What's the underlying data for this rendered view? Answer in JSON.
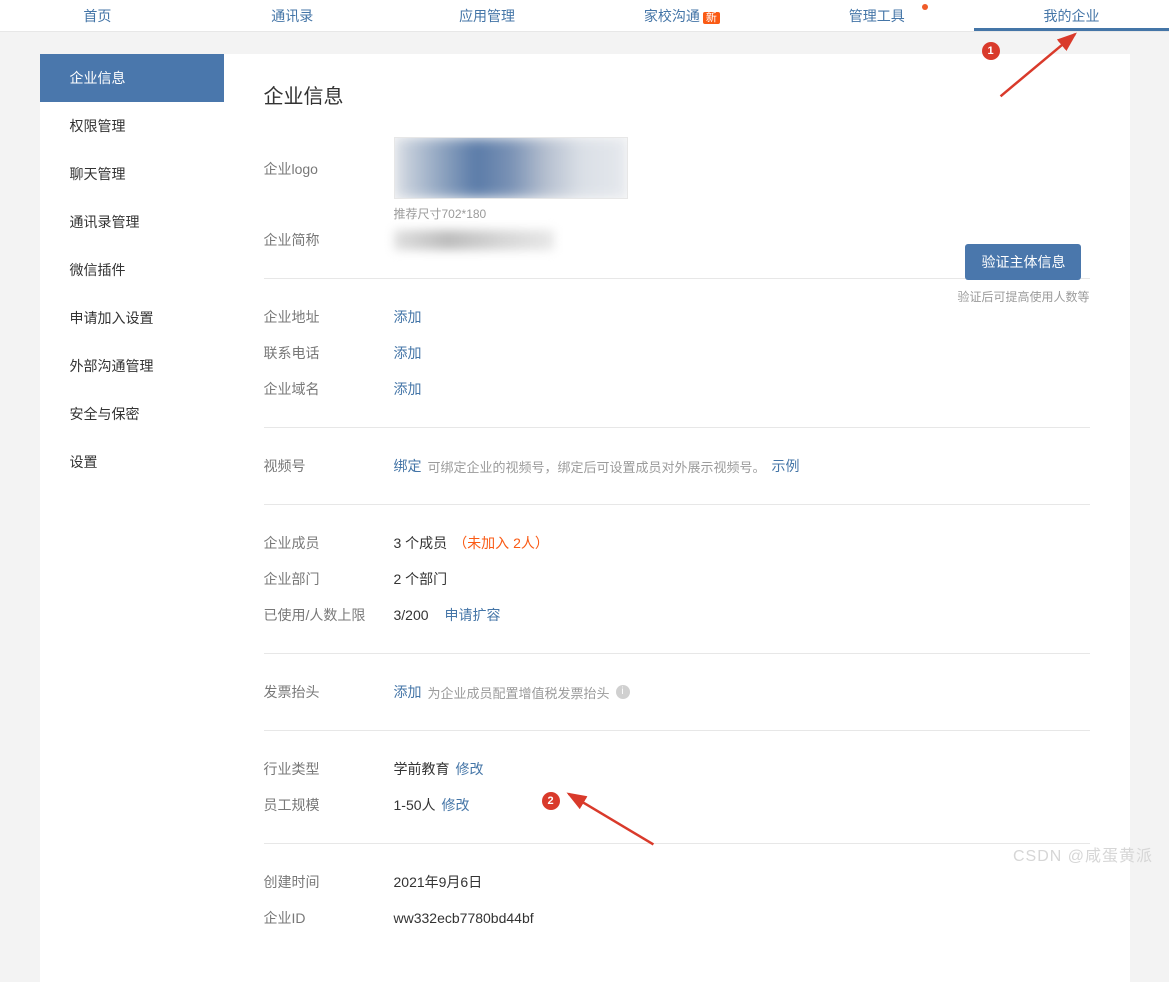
{
  "nav": {
    "items": [
      {
        "label": "首页"
      },
      {
        "label": "通讯录"
      },
      {
        "label": "应用管理"
      },
      {
        "label": "家校沟通",
        "badge": "新"
      },
      {
        "label": "管理工具",
        "dot": true
      },
      {
        "label": "我的企业",
        "active": true
      }
    ]
  },
  "sidebar": {
    "items": [
      {
        "label": "企业信息",
        "active": true
      },
      {
        "label": "权限管理"
      },
      {
        "label": "聊天管理"
      },
      {
        "label": "通讯录管理"
      },
      {
        "label": "微信插件"
      },
      {
        "label": "申请加入设置"
      },
      {
        "label": "外部沟通管理"
      },
      {
        "label": "安全与保密"
      },
      {
        "label": "设置"
      }
    ]
  },
  "page": {
    "title": "企业信息",
    "logo_label": "企业logo",
    "logo_hint": "推荐尺寸702*180",
    "short_name_label": "企业简称",
    "verify_btn": "验证主体信息",
    "verify_hint": "验证后可提高使用人数等",
    "address_label": "企业地址",
    "address_action": "添加",
    "phone_label": "联系电话",
    "phone_action": "添加",
    "domain_label": "企业域名",
    "domain_action": "添加",
    "video_label": "视频号",
    "video_action": "绑定",
    "video_hint": "可绑定企业的视频号，绑定后可设置成员对外展示视频号。",
    "video_example": "示例",
    "members_label": "企业成员",
    "members_value": "3 个成员",
    "members_pending": "（未加入 2人）",
    "depts_label": "企业部门",
    "depts_value": "2 个部门",
    "quota_label": "已使用/人数上限",
    "quota_value": "3/200",
    "quota_action": "申请扩容",
    "invoice_label": "发票抬头",
    "invoice_action": "添加",
    "invoice_hint": "为企业成员配置增值税发票抬头",
    "industry_label": "行业类型",
    "industry_value": "学前教育",
    "industry_action": "修改",
    "scale_label": "员工规模",
    "scale_value": "1-50人",
    "scale_action": "修改",
    "created_label": "创建时间",
    "created_value": "2021年9月6日",
    "corpid_label": "企业ID",
    "corpid_value": "ww332ecb7780bd44bf"
  },
  "watermark": "CSDN @咸蛋黄派",
  "annotations": {
    "one": "1",
    "two": "2"
  }
}
